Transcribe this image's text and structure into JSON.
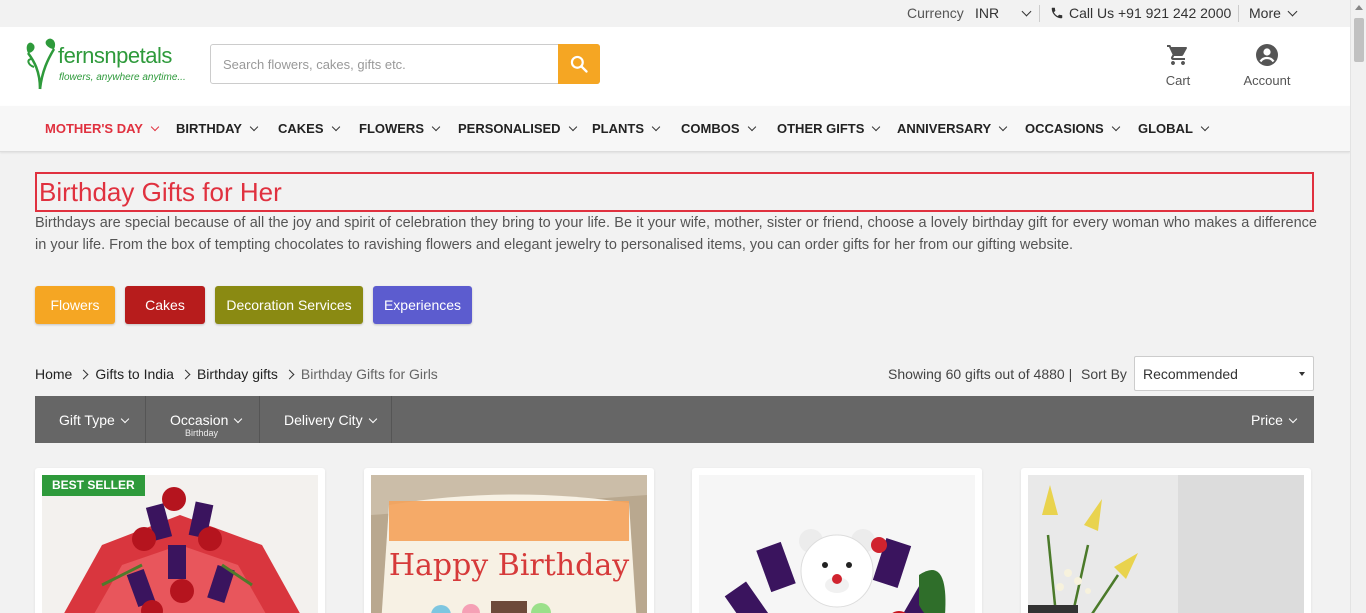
{
  "topbar": {
    "currency_label": "Currency",
    "currency_value": "INR",
    "call_label": "Call Us +91 921 242 2000",
    "more_label": "More"
  },
  "header": {
    "logo_text": "fernsnpetals",
    "logo_tagline": "flowers, anywhere anytime...",
    "search_placeholder": "Search flowers, cakes, gifts etc.",
    "cart_label": "Cart",
    "account_label": "Account"
  },
  "nav": {
    "items": [
      {
        "label": "MOTHER'S DAY"
      },
      {
        "label": "BIRTHDAY"
      },
      {
        "label": "CAKES"
      },
      {
        "label": "FLOWERS"
      },
      {
        "label": "PERSONALISED"
      },
      {
        "label": "PLANTS"
      },
      {
        "label": "COMBOS"
      },
      {
        "label": "OTHER GIFTS"
      },
      {
        "label": "ANNIVERSARY"
      },
      {
        "label": "OCCASIONS"
      },
      {
        "label": "GLOBAL"
      }
    ]
  },
  "main": {
    "title": "Birthday Gifts for Her",
    "description": "Birthdays are special because of all the joy and spirit of celebration they bring to your life. Be it your wife, mother, sister or friend, choose a lovely birthday gift for every woman who makes a difference in your life. From the box of tempting chocolates to ravishing flowers and elegant jewelry to personalised items, you can order gifts for her from our gifting website.",
    "categories": [
      {
        "label": "Flowers",
        "color": "#f5a623"
      },
      {
        "label": "Cakes",
        "color": "#b71c1c"
      },
      {
        "label": "Decoration Services",
        "color": "#8a8a12"
      },
      {
        "label": "Experiences",
        "color": "#5c5ccf"
      }
    ],
    "breadcrumb": [
      "Home",
      "Gifts to India",
      "Birthday gifts",
      "Birthday Gifts for Girls"
    ],
    "showing_text": "Showing 60 gifts out of 4880 |",
    "sort_label": "Sort By",
    "sort_value": "Recommended",
    "filters": {
      "gift_type": "Gift Type",
      "occasion": "Occasion",
      "occasion_sub": "Birthday",
      "delivery_city": "Delivery City",
      "price": "Price"
    },
    "products": {
      "badge": "BEST SELLER"
    }
  },
  "colors": {
    "accent": "#e0313f",
    "brand": "#2e9a3b",
    "search_button": "#f5a623"
  }
}
